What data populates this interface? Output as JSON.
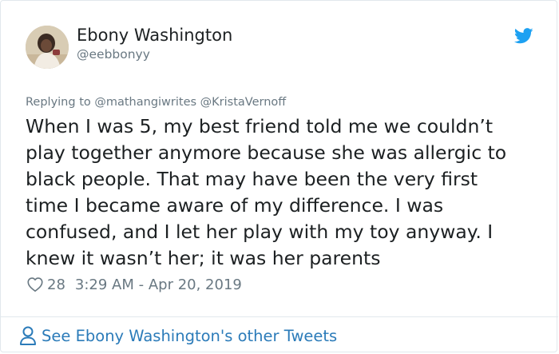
{
  "author": {
    "name": "Ebony Washington",
    "handle": "@eebbonyy"
  },
  "reply_context": "Replying to @mathangiwrites @KristaVernoff",
  "tweet_lines": [
    "When I was 5, my best friend told me we couldn’t",
    "play together anymore because she was allergic to",
    "black people. That may have been the very first",
    "time I became aware of my difference. I was",
    "confused, and I let her play with my toy anyway. I",
    "knew it wasn’t her; it was her parents"
  ],
  "likes": "28",
  "timestamp": "3:29 AM - Apr 20, 2019",
  "footer_link": "See Ebony Washington's other Tweets",
  "icons": {
    "brand": "twitter-bird-icon",
    "like": "heart-icon",
    "profile": "person-icon"
  },
  "colors": {
    "text": "#1c2022",
    "secondary": "#697882",
    "link": "#2b7bb9",
    "twitter_blue": "#1da1f2",
    "border": "#e1e8ed"
  }
}
